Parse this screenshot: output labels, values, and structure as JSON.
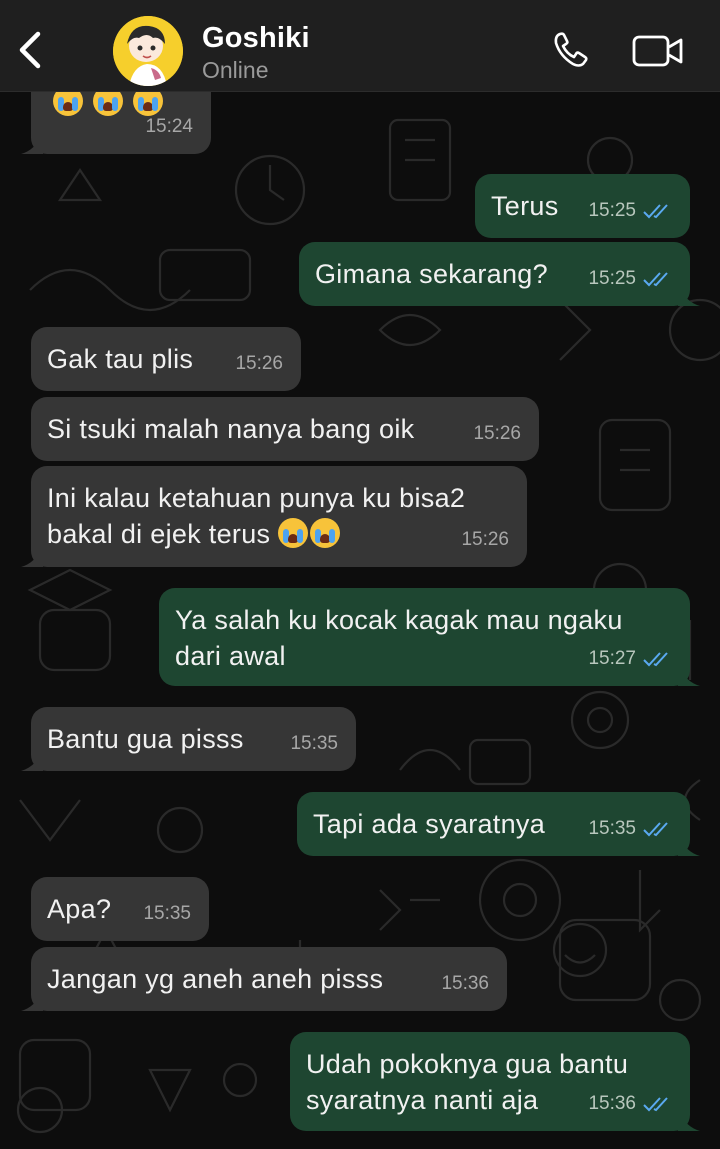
{
  "header": {
    "contact_name": "Goshiki",
    "status": "Online",
    "back_icon": "chevron-left-icon",
    "call_icon": "phone-icon",
    "video_icon": "video-camera-icon"
  },
  "colors": {
    "incoming_bubble": "#363636",
    "outgoing_bubble": "#1e4631",
    "read_ticks": "#5aa9f0",
    "header_bg": "#1f1f1f"
  },
  "messages": [
    {
      "direction": "in",
      "text": "",
      "emoji": "😭😭😭",
      "time": "15:24"
    },
    {
      "direction": "out",
      "text": "Terus",
      "time": "15:25",
      "status": "read"
    },
    {
      "direction": "out",
      "text": "Gimana sekarang?",
      "time": "15:25",
      "status": "read"
    },
    {
      "direction": "in",
      "text": "Gak tau plis",
      "time": "15:26"
    },
    {
      "direction": "in",
      "text": "Si tsuki malah nanya bang oik",
      "time": "15:26"
    },
    {
      "direction": "in",
      "text_line1": "Ini kalau ketahuan punya ku bisa2",
      "text_line2": "bakal di ejek terus",
      "emoji": "😭😭",
      "time": "15:26"
    },
    {
      "direction": "out",
      "text_line1": "Ya salah ku kocak kagak mau ngaku",
      "text_line2": "dari awal",
      "time": "15:27",
      "status": "read"
    },
    {
      "direction": "in",
      "text": "Bantu gua pisss",
      "time": "15:35"
    },
    {
      "direction": "out",
      "text": "Tapi ada syaratnya",
      "time": "15:35",
      "status": "read"
    },
    {
      "direction": "in",
      "text": "Apa?",
      "time": "15:35"
    },
    {
      "direction": "in",
      "text": "Jangan yg aneh aneh pisss",
      "time": "15:36"
    },
    {
      "direction": "out",
      "text_line1": "Udah pokoknya gua bantu",
      "text_line2": "syaratnya nanti aja",
      "time": "15:36",
      "status": "read"
    }
  ]
}
